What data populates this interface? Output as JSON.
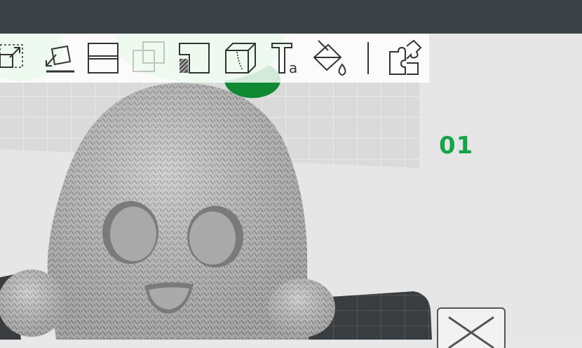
{
  "window": {
    "title": ""
  },
  "toolbar": {
    "tools": [
      {
        "name": "scale-icon",
        "enabled": true
      },
      {
        "name": "lay-on-face-icon",
        "enabled": true
      },
      {
        "name": "cut-icon",
        "enabled": true
      },
      {
        "name": "mesh-boolean-icon",
        "enabled": false
      },
      {
        "name": "support-painting-icon",
        "enabled": true
      },
      {
        "name": "seam-painting-icon",
        "enabled": true
      },
      {
        "name": "text-shape-icon",
        "enabled": true
      },
      {
        "name": "color-painting-icon",
        "enabled": true
      },
      {
        "name": "assembly-icon",
        "enabled": true
      }
    ]
  },
  "plate": {
    "label": "01",
    "label_color": "#17a349"
  },
  "colors": {
    "titlebar": "#3b4246",
    "viewport_bg": "#e6e6e6",
    "bed_grid": "#d2d2d2",
    "model": "#b9b9b9",
    "plate_dark": "#3a3d40",
    "accent_green": "#17a349"
  }
}
